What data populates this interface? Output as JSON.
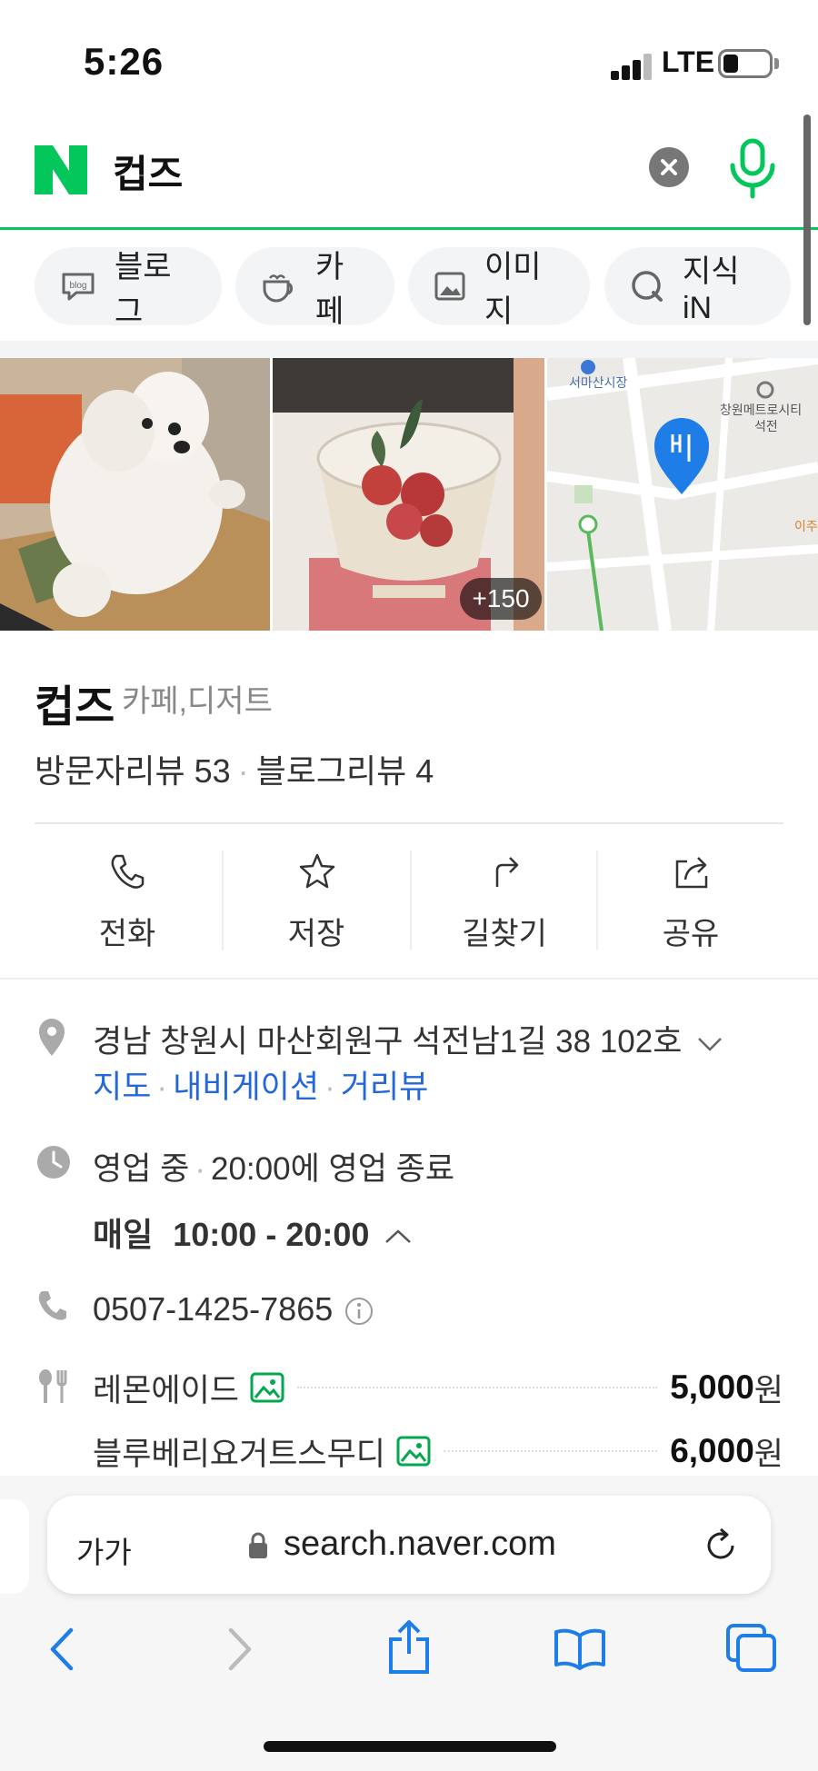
{
  "status_bar": {
    "time": "5:26",
    "network": "LTE"
  },
  "search": {
    "query": "컵즈",
    "accent_color": "#03c75a"
  },
  "tabs": [
    {
      "label": "블로그",
      "icon": "blog-icon"
    },
    {
      "label": "카페",
      "icon": "cafe-cup-icon"
    },
    {
      "label": "이미지",
      "icon": "image-icon"
    },
    {
      "label": "지식iN",
      "icon": "kin-icon"
    }
  ],
  "gallery": {
    "photo_count_badge": "+150"
  },
  "place": {
    "name": "컵즈",
    "category": "카페,디저트",
    "visitor_reviews": "방문자리뷰 53",
    "blog_reviews": "블로그리뷰 4"
  },
  "actions": [
    {
      "label": "전화",
      "icon": "phone-icon"
    },
    {
      "label": "저장",
      "icon": "star-icon"
    },
    {
      "label": "길찾기",
      "icon": "directions-icon"
    },
    {
      "label": "공유",
      "icon": "share-icon"
    }
  ],
  "info": {
    "address": "경남 창원시 마산회원구 석전남1길 38 102호",
    "links": [
      "지도",
      "내비게이션",
      "거리뷰"
    ],
    "status": "영업 중",
    "closing": "20:00에 영업 종료",
    "daily_label": "매일",
    "daily_hours": "10:00 - 20:00",
    "phone": "0507-1425-7865",
    "menu": [
      {
        "name": "레몬에이드",
        "price": "5,000",
        "unit": "원"
      },
      {
        "name": "블루베리요거트스무디",
        "price": "6,000",
        "unit": "원"
      }
    ]
  },
  "map": {
    "labels": [
      "서마산시장",
      "창원메트로시티",
      "석전",
      "이주"
    ]
  },
  "browser": {
    "text_size": "가가",
    "url": "search.naver.com"
  }
}
